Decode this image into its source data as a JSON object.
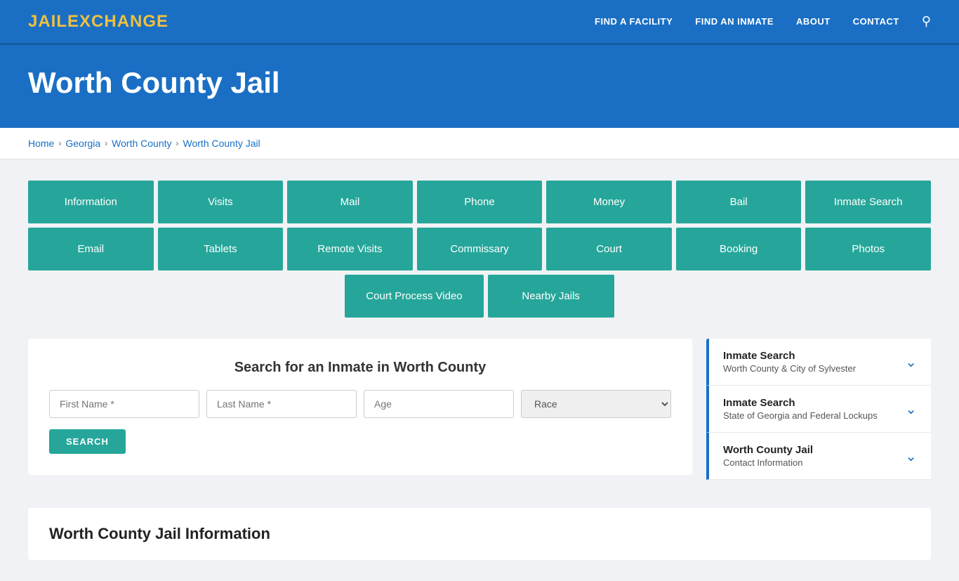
{
  "header": {
    "logo_jail": "JAIL",
    "logo_exchange": "EXCHANGE",
    "nav": [
      {
        "label": "FIND A FACILITY",
        "id": "find-facility"
      },
      {
        "label": "FIND AN INMATE",
        "id": "find-inmate"
      },
      {
        "label": "ABOUT",
        "id": "about"
      },
      {
        "label": "CONTACT",
        "id": "contact"
      }
    ]
  },
  "hero": {
    "title": "Worth County Jail"
  },
  "breadcrumb": {
    "items": [
      {
        "label": "Home",
        "id": "home"
      },
      {
        "label": "Georgia",
        "id": "georgia"
      },
      {
        "label": "Worth County",
        "id": "worth-county"
      },
      {
        "label": "Worth County Jail",
        "id": "worth-county-jail"
      }
    ]
  },
  "grid_row1": [
    {
      "label": "Information",
      "id": "btn-information"
    },
    {
      "label": "Visits",
      "id": "btn-visits"
    },
    {
      "label": "Mail",
      "id": "btn-mail"
    },
    {
      "label": "Phone",
      "id": "btn-phone"
    },
    {
      "label": "Money",
      "id": "btn-money"
    },
    {
      "label": "Bail",
      "id": "btn-bail"
    },
    {
      "label": "Inmate Search",
      "id": "btn-inmate-search"
    }
  ],
  "grid_row2": [
    {
      "label": "Email",
      "id": "btn-email"
    },
    {
      "label": "Tablets",
      "id": "btn-tablets"
    },
    {
      "label": "Remote Visits",
      "id": "btn-remote-visits"
    },
    {
      "label": "Commissary",
      "id": "btn-commissary"
    },
    {
      "label": "Court",
      "id": "btn-court"
    },
    {
      "label": "Booking",
      "id": "btn-booking"
    },
    {
      "label": "Photos",
      "id": "btn-photos"
    }
  ],
  "grid_row3": [
    {
      "label": "Court Process Video",
      "id": "btn-court-process-video"
    },
    {
      "label": "Nearby Jails",
      "id": "btn-nearby-jails"
    }
  ],
  "search": {
    "title": "Search for an Inmate in Worth County",
    "first_name_placeholder": "First Name *",
    "last_name_placeholder": "Last Name *",
    "age_placeholder": "Age",
    "race_placeholder": "Race",
    "button_label": "SEARCH"
  },
  "sidebar": [
    {
      "title": "Inmate Search",
      "subtitle": "Worth County & City of Sylvester",
      "id": "sidebar-inmate-search-1"
    },
    {
      "title": "Inmate Search",
      "subtitle": "State of Georgia and Federal Lockups",
      "id": "sidebar-inmate-search-2"
    },
    {
      "title": "Worth County Jail",
      "subtitle": "Contact Information",
      "id": "sidebar-contact-info"
    }
  ],
  "info_section": {
    "title": "Worth County Jail Information"
  }
}
